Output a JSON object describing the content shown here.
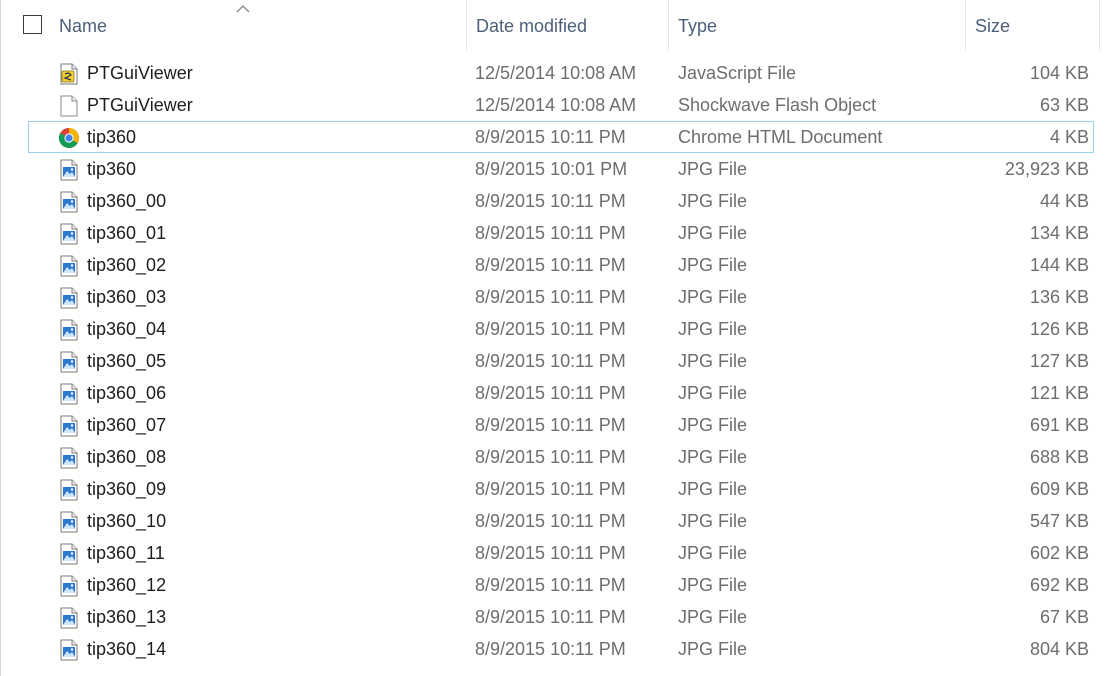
{
  "header": {
    "name_label": "Name",
    "date_label": "Date modified",
    "type_label": "Type",
    "size_label": "Size",
    "sort_indicator": "ascending"
  },
  "focused_index": 2,
  "colors": {
    "header_text": "#4c607a",
    "focus_border": "#99d1ec",
    "detail_text": "#6d6d6d"
  },
  "files": [
    {
      "name": "PTGuiViewer",
      "date": "12/5/2014 10:08 AM",
      "type": "JavaScript File",
      "size": "104 KB",
      "icon": "js"
    },
    {
      "name": "PTGuiViewer",
      "date": "12/5/2014 10:08 AM",
      "type": "Shockwave Flash Object",
      "size": "63 KB",
      "icon": "blank"
    },
    {
      "name": "tip360",
      "date": "8/9/2015 10:11 PM",
      "type": "Chrome HTML Document",
      "size": "4 KB",
      "icon": "chrome"
    },
    {
      "name": "tip360",
      "date": "8/9/2015 10:01 PM",
      "type": "JPG File",
      "size": "23,923 KB",
      "icon": "jpg"
    },
    {
      "name": "tip360_00",
      "date": "8/9/2015 10:11 PM",
      "type": "JPG File",
      "size": "44 KB",
      "icon": "jpg"
    },
    {
      "name": "tip360_01",
      "date": "8/9/2015 10:11 PM",
      "type": "JPG File",
      "size": "134 KB",
      "icon": "jpg"
    },
    {
      "name": "tip360_02",
      "date": "8/9/2015 10:11 PM",
      "type": "JPG File",
      "size": "144 KB",
      "icon": "jpg"
    },
    {
      "name": "tip360_03",
      "date": "8/9/2015 10:11 PM",
      "type": "JPG File",
      "size": "136 KB",
      "icon": "jpg"
    },
    {
      "name": "tip360_04",
      "date": "8/9/2015 10:11 PM",
      "type": "JPG File",
      "size": "126 KB",
      "icon": "jpg"
    },
    {
      "name": "tip360_05",
      "date": "8/9/2015 10:11 PM",
      "type": "JPG File",
      "size": "127 KB",
      "icon": "jpg"
    },
    {
      "name": "tip360_06",
      "date": "8/9/2015 10:11 PM",
      "type": "JPG File",
      "size": "121 KB",
      "icon": "jpg"
    },
    {
      "name": "tip360_07",
      "date": "8/9/2015 10:11 PM",
      "type": "JPG File",
      "size": "691 KB",
      "icon": "jpg"
    },
    {
      "name": "tip360_08",
      "date": "8/9/2015 10:11 PM",
      "type": "JPG File",
      "size": "688 KB",
      "icon": "jpg"
    },
    {
      "name": "tip360_09",
      "date": "8/9/2015 10:11 PM",
      "type": "JPG File",
      "size": "609 KB",
      "icon": "jpg"
    },
    {
      "name": "tip360_10",
      "date": "8/9/2015 10:11 PM",
      "type": "JPG File",
      "size": "547 KB",
      "icon": "jpg"
    },
    {
      "name": "tip360_11",
      "date": "8/9/2015 10:11 PM",
      "type": "JPG File",
      "size": "602 KB",
      "icon": "jpg"
    },
    {
      "name": "tip360_12",
      "date": "8/9/2015 10:11 PM",
      "type": "JPG File",
      "size": "692 KB",
      "icon": "jpg"
    },
    {
      "name": "tip360_13",
      "date": "8/9/2015 10:11 PM",
      "type": "JPG File",
      "size": "67 KB",
      "icon": "jpg"
    },
    {
      "name": "tip360_14",
      "date": "8/9/2015 10:11 PM",
      "type": "JPG File",
      "size": "804 KB",
      "icon": "jpg"
    }
  ]
}
